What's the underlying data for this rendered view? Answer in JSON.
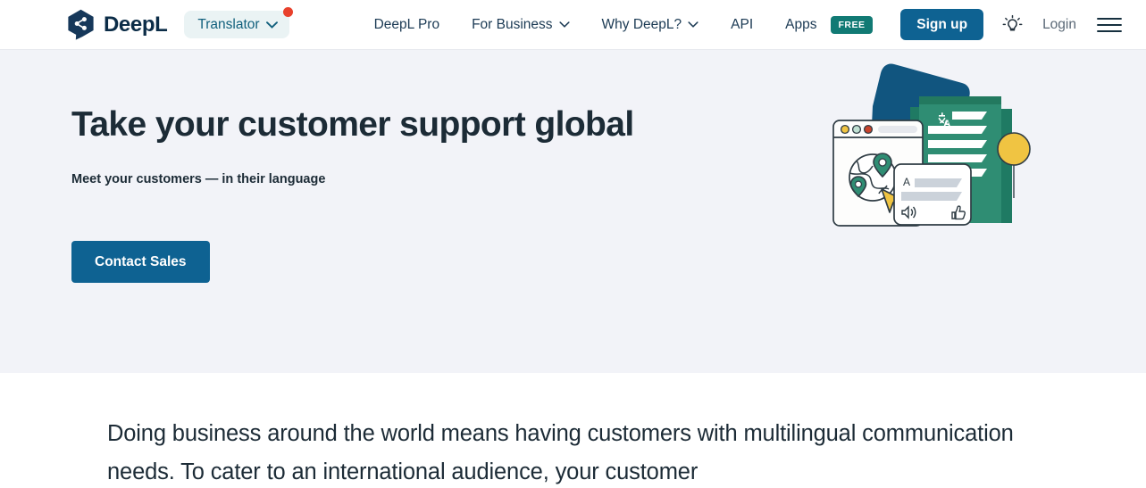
{
  "header": {
    "brand": {
      "name": "DeepL",
      "logo_icon": "deepl-logo-icon"
    },
    "product_switcher": {
      "label": "Translator",
      "chevron_icon": "chevron-down-icon",
      "badge_icon": "notification-dot"
    },
    "nav": [
      {
        "label": "DeepL Pro",
        "has_chevron": false,
        "badge": null
      },
      {
        "label": "For Business",
        "has_chevron": true,
        "badge": null
      },
      {
        "label": "Why DeepL?",
        "has_chevron": true,
        "badge": null
      },
      {
        "label": "API",
        "has_chevron": false,
        "badge": null
      },
      {
        "label": "Apps",
        "has_chevron": false,
        "badge": "FREE"
      }
    ],
    "signup_label": "Sign up",
    "theme_toggle_icon": "lightbulb-icon",
    "login_label": "Login",
    "menu_icon": "hamburger-menu-icon"
  },
  "hero": {
    "title": "Take your customer support global",
    "subtitle": "Meet your customers — in their language",
    "cta_label": "Contact Sales",
    "illustration_name": "customer-support-globalization-illustration"
  },
  "content": {
    "paragraph": "Doing business around the world means having customers with multilingual communication needs. To cater to an international audience, your customer"
  },
  "colors": {
    "brand_navy": "#0b2c47",
    "primary_blue": "#0e6292",
    "teal_badge": "#117a74",
    "hero_background": "#f2f3f8",
    "pill_background": "#eaf3f4",
    "pill_text": "#11607d",
    "notification_red": "#e8412c",
    "illustration_green": "#2e8b6f",
    "illustration_dark_blue": "#11557f",
    "illustration_yellow": "#f0c442"
  }
}
